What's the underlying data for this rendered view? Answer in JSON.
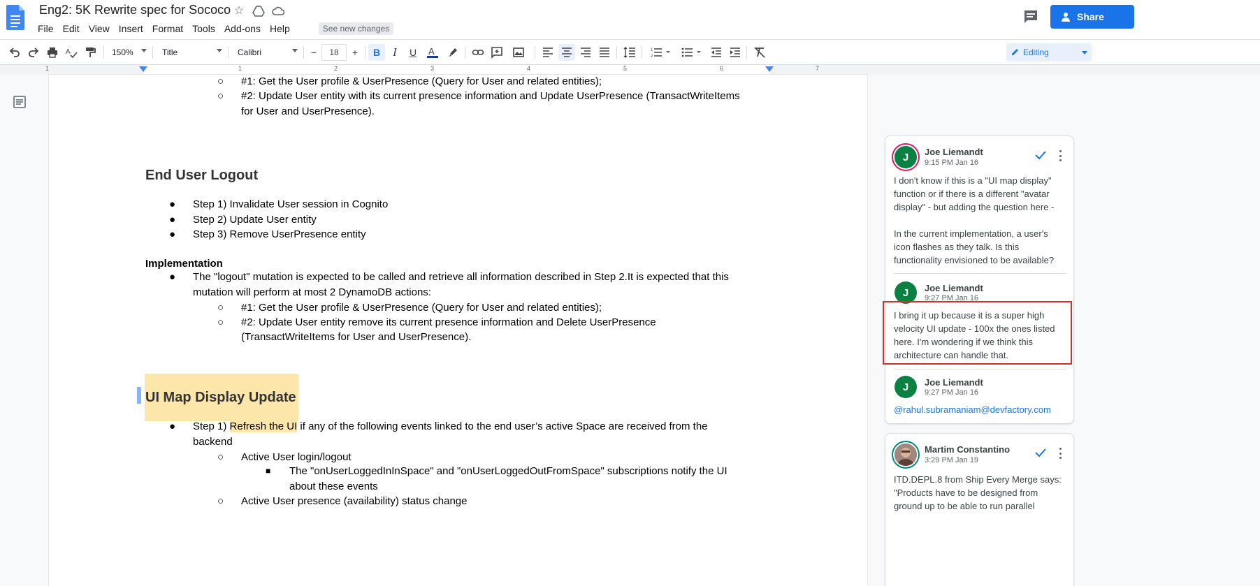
{
  "app": {
    "title": "Eng2: 5K Rewrite spec for Sococo",
    "menu": [
      "File",
      "Edit",
      "View",
      "Insert",
      "Format",
      "Tools",
      "Add-ons",
      "Help"
    ],
    "see_new_changes": "See new changes",
    "share_label": "Share",
    "accent_color": "#1a73e8"
  },
  "toolbar": {
    "zoom": "150%",
    "style": "Title",
    "font": "Calibri",
    "font_size": "18",
    "mode": "Editing",
    "icons": [
      "undo-icon",
      "redo-icon",
      "print-icon",
      "spellcheck-icon",
      "paint-format-icon",
      "bold-icon",
      "italic-icon",
      "underline-icon",
      "text-color-icon",
      "highlight-icon",
      "link-icon",
      "add-comment-icon",
      "image-icon",
      "align-left-icon",
      "align-center-icon",
      "align-right-icon",
      "justify-icon",
      "line-spacing-icon",
      "numbered-list-icon",
      "bulleted-list-icon",
      "decrease-indent-icon",
      "increase-indent-icon",
      "clear-formatting-icon"
    ]
  },
  "ruler": {
    "numbers": [
      "1",
      "1",
      "2",
      "3",
      "4",
      "5",
      "6",
      "7"
    ]
  },
  "document": {
    "top_lines": [
      "#1: Get the User profile & UserPresence (Query for User and related entities);",
      "#2: Update User entity with its current presence information and Update UserPresence (TransactWriteItems",
      "for User and UserPresence)."
    ],
    "logout_heading": "End User Logout",
    "logout_steps": [
      "Step 1) Invalidate User session in Cognito",
      "Step 2) Update User entity",
      "Step 3) Remove UserPresence entity"
    ],
    "implementation_label": "Implementation",
    "impl_line1": "The \"logout\" mutation is expected to be called and retrieve all information described in Step 2.It is expected that this",
    "impl_line2": "mutation will perform at most 2 DynamoDB actions:",
    "impl_sub1": "#1: Get the User profile & UserPresence (Query for User and related entities);",
    "impl_sub2a": "#2: Update User entity remove its current presence information and Delete UserPresence",
    "impl_sub2b": "(TransactWriteItems for User and UserPresence).",
    "ui_map_heading": "UI Map Display Update",
    "ui_step1_pre": "Step 1) ",
    "ui_step1_hl": "Refresh the UI",
    "ui_step1_post": " if any of the following events linked to the end user’s active Space are received from the",
    "ui_step1_cont": "backend",
    "ui_sub1": "Active User login/logout",
    "ui_sub1_detail_a": "The \"onUserLoggedInInSpace\" and \"onUserLoggedOutFromSpace\" subscriptions notify the UI",
    "ui_sub1_detail_b": "about these events",
    "ui_sub2": "Active User presence (availability) status change"
  },
  "comments": [
    {
      "author": "Joe Liemandt",
      "initial": "J",
      "time": "9:15 PM Jan 16",
      "text_lines": [
        "I don't know if this is a \"UI map display\"",
        "function or if there is a different \"avatar",
        "display\" - but adding the question here -",
        "",
        "In the current implementation, a user's",
        "icon flashes as they talk.  Is this",
        "functionality envisioned to be available?"
      ]
    },
    {
      "author": "Joe Liemandt",
      "initial": "J",
      "time": "9:27 PM Jan 16",
      "text_lines": [
        "I bring it up because it is a super high",
        "velocity UI update - 100x the ones listed",
        "here.  I'm wondering if we think this",
        "architecture can handle that."
      ]
    },
    {
      "author": "Joe Liemandt",
      "initial": "J",
      "time": "9:27 PM Jan 16",
      "mention": "@rahul.subramaniam@devfactory.com"
    },
    {
      "author": "Martim Constantino",
      "time": "3:29 PM Jan 19",
      "text_lines": [
        "ITD.DEPL.8 from Ship Every Merge says:",
        "\"Products have to be designed from",
        "ground up to be able to run parallel"
      ]
    }
  ]
}
